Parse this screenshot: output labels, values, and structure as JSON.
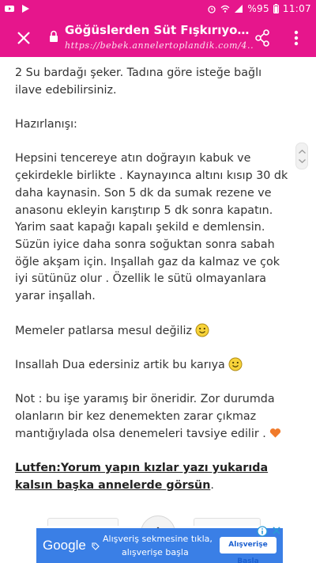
{
  "status_bar": {
    "icons_left": [
      "youtube-icon",
      "play-store-icon"
    ],
    "icons_right": [
      "alarm-icon",
      "hd-wifi-icon",
      "signal-icon"
    ],
    "battery": "%95",
    "time": "11:07"
  },
  "toolbar": {
    "title": "Göğüslerden Süt Fışkırıyor (Sü...",
    "url": "https://bebek.annelertoplandik.com/4...",
    "close_icon": "close-icon",
    "lock_icon": "lock-icon",
    "share_icon": "share-icon",
    "more_icon": "more-vert-icon"
  },
  "article": {
    "p1": "2 Su bardağı şeker.  Tadına göre isteğe bağlı ilave edebilirsiniz.",
    "heading": "Hazırlanışı:",
    "p2": "Hepsini tencereye atın doğrayın kabuk ve çekirdekle birlikte . Kaynayınca altını kısıp 30 dk daha kaynasin. Son 5 dk da sumak rezene ve anasonu ekleyin karıştırıp 5 dk sonra kapatın.  Yarim saat kapağı kapalı şekild e demlensin.  Süzün iyice daha sonra soğuktan sonra sabah öğle akşam için.  Inşallah gaz da kalmaz ve çok iyi sütünüz olur . Özellik le sütü olmayanlara yarar inşallah.",
    "p3": "Memeler patlarsa mesul değiliz",
    "p4": "Insallah Dua edersiniz artik bu karıya",
    "p5": "Not : bu işe yaramış bir öneridir.  Zor durumda olanların bir kez denemekten zarar çıkmaz mantığıylada olsa denemeleri tavsiye edilir .",
    "p6_bold": "Lutfen:Yorum yapın kızlar yazı yukarıda kalsın başka annelerde görsün",
    "p6_end": "."
  },
  "ad": {
    "brand": "Google",
    "line1": "Alışveriş  sekmesine tıkla,",
    "line2": "alışverişe başla",
    "cta": "Alışverişe Başla",
    "info_icon": "ad-info-icon",
    "close_icon": "ad-close-icon"
  },
  "colors": {
    "accent": "#e6168c",
    "ad_blue": "#3a7fe6",
    "text": "#333333"
  }
}
